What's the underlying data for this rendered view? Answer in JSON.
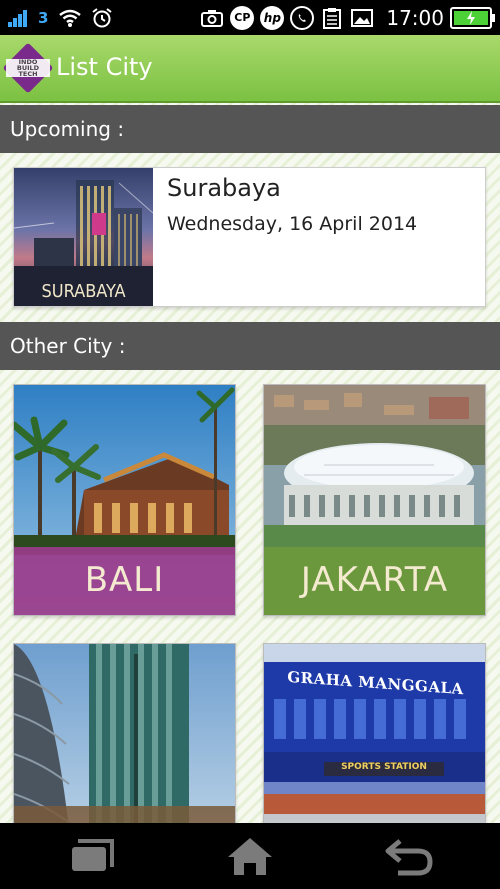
{
  "status_bar": {
    "network": "3",
    "icons": [
      "signal-icon",
      "wifi-icon",
      "alarm-icon",
      "camera-icon",
      "cp-icon",
      "hp-icon",
      "whatsapp-icon",
      "clipboard-icon",
      "image-icon",
      "battery-icon"
    ],
    "cp_label": "CP",
    "hp_label": "hp",
    "time": "17:00"
  },
  "app_bar": {
    "logo_text": [
      "INDO",
      "BUILD",
      "TECH"
    ],
    "title": "List City",
    "color": "#8cc63f"
  },
  "upcoming": {
    "header": "Upcoming :",
    "city": "Surabaya",
    "date": "Wednesday, 16 April 2014",
    "image_caption": "SURABAYA"
  },
  "other": {
    "header": "Other City :",
    "cities": [
      {
        "caption": "BALI",
        "caption_color": "#9b3b8a"
      },
      {
        "caption": "JAKARTA",
        "caption_color": "#6f9a3a"
      },
      {
        "caption": "",
        "caption_color": "#7a5a3a"
      },
      {
        "caption": "",
        "caption_color": "#3355aa"
      }
    ],
    "card4_sign": "GRAHA MANGGALA",
    "card4_sign2": "SPORTS STATION"
  },
  "nav_bar": {
    "icons": [
      "recent-apps-icon",
      "home-icon",
      "back-icon"
    ]
  }
}
